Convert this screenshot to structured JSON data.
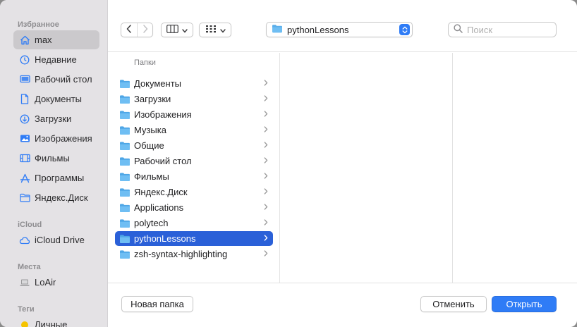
{
  "sidebar": {
    "sections": {
      "favorites": "Избранное",
      "icloud": "iCloud",
      "locations": "Места",
      "tags": "Теги"
    },
    "favorites": [
      {
        "label": "max",
        "icon": "home-icon",
        "selected": true
      },
      {
        "label": "Недавние",
        "icon": "clock-icon"
      },
      {
        "label": "Рабочий стол",
        "icon": "desktop-icon"
      },
      {
        "label": "Документы",
        "icon": "document-icon"
      },
      {
        "label": "Загрузки",
        "icon": "download-icon"
      },
      {
        "label": "Изображения",
        "icon": "photo-icon"
      },
      {
        "label": "Фильмы",
        "icon": "film-icon"
      },
      {
        "label": "Программы",
        "icon": "apps-icon"
      },
      {
        "label": "Яндекс.Диск",
        "icon": "folder-icon"
      }
    ],
    "icloud": [
      {
        "label": "iCloud Drive",
        "icon": "cloud-icon"
      }
    ],
    "locations": [
      {
        "label": "LoAir",
        "icon": "laptop-icon"
      }
    ],
    "tags": [
      {
        "label": "Личные",
        "icon": "tag-dot-icon",
        "color": "#f5c400"
      }
    ]
  },
  "toolbar": {
    "back_icon": "chevron-left-icon",
    "forward_icon": "chevron-right-icon",
    "view_icon": "columns-view-icon",
    "group_icon": "grid-view-icon",
    "path": "pythonLessons",
    "search_placeholder": "Поиск"
  },
  "browser": {
    "column_header": "Папки",
    "folders": [
      {
        "name": "Документы",
        "selected": false
      },
      {
        "name": "Загрузки",
        "selected": false
      },
      {
        "name": "Изображения",
        "selected": false
      },
      {
        "name": "Музыка",
        "selected": false
      },
      {
        "name": "Общие",
        "selected": false
      },
      {
        "name": "Рабочий стол",
        "selected": false
      },
      {
        "name": "Фильмы",
        "selected": false
      },
      {
        "name": "Яндекс.Диск",
        "selected": false
      },
      {
        "name": "Applications",
        "selected": false
      },
      {
        "name": "polytech",
        "selected": false
      },
      {
        "name": "pythonLessons",
        "selected": true
      },
      {
        "name": "zsh-syntax-highlighting",
        "selected": false
      }
    ]
  },
  "footer": {
    "new_folder": "Новая папка",
    "cancel": "Отменить",
    "open": "Открыть"
  },
  "colors": {
    "accent": "#2f7cf6",
    "selection": "#2a60d8",
    "folder": "#5aaeea"
  }
}
